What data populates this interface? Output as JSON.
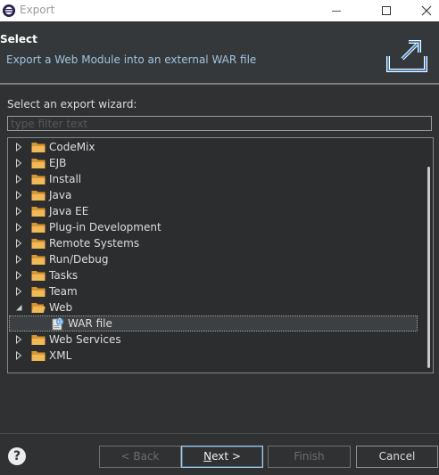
{
  "window": {
    "title": "Export"
  },
  "header": {
    "title": "Select",
    "description": "Export a Web Module into an external WAR file"
  },
  "wizard": {
    "label": "Select an export wizard:",
    "filter_placeholder": "type filter text"
  },
  "tree": {
    "items": [
      {
        "label": "CodeMix",
        "expanded": false
      },
      {
        "label": "EJB",
        "expanded": false
      },
      {
        "label": "Install",
        "expanded": false
      },
      {
        "label": "Java",
        "expanded": false
      },
      {
        "label": "Java EE",
        "expanded": false
      },
      {
        "label": "Plug-in Development",
        "expanded": false
      },
      {
        "label": "Remote Systems",
        "expanded": false
      },
      {
        "label": "Run/Debug",
        "expanded": false
      },
      {
        "label": "Tasks",
        "expanded": false
      },
      {
        "label": "Team",
        "expanded": false
      },
      {
        "label": "Web",
        "expanded": true,
        "children": [
          {
            "label": "WAR file",
            "selected": true
          }
        ]
      },
      {
        "label": "Web Services",
        "expanded": false
      },
      {
        "label": "XML",
        "expanded": false
      }
    ]
  },
  "buttons": {
    "back": "< Back",
    "next_mnemonic": "N",
    "next_rest": "ext >",
    "finish": "Finish",
    "cancel": "Cancel",
    "help": "?"
  },
  "colors": {
    "background": "#2f3132",
    "folder": "#e8a642",
    "description_text": "#9fc4df"
  }
}
